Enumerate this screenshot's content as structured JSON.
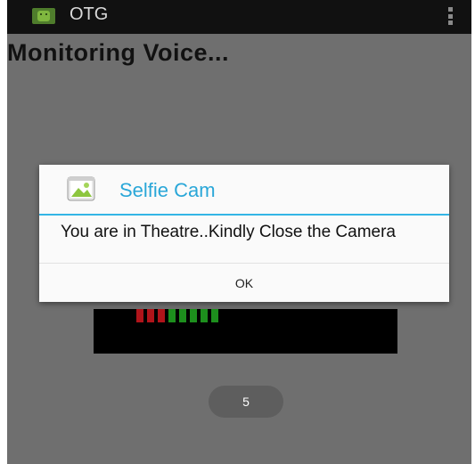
{
  "action_bar": {
    "title": "OTG",
    "icon": "android-app-icon",
    "menu_icon": "overflow-menu-icon"
  },
  "screen": {
    "heading": "Monitoring Voice..."
  },
  "meter": {
    "segments": [
      {
        "color": "#b0141a"
      },
      {
        "color": "#b0141a"
      },
      {
        "color": "#b0141a"
      },
      {
        "color": "#1d8f1d"
      },
      {
        "color": "#1d8f1d"
      },
      {
        "color": "#1d8f1d"
      },
      {
        "color": "#1d8f1d"
      },
      {
        "color": "#1d8f1d"
      }
    ]
  },
  "counter": {
    "value": "5"
  },
  "dialog": {
    "title": "Selfie Cam",
    "icon": "gallery-app-icon",
    "message": "You are in Theatre..Kindly Close the Camera",
    "ok_label": "OK"
  },
  "colors": {
    "dialog_title": "#2aa7d8",
    "dialog_divider": "#33b5e5",
    "dim_background": "#6f6f6f"
  }
}
